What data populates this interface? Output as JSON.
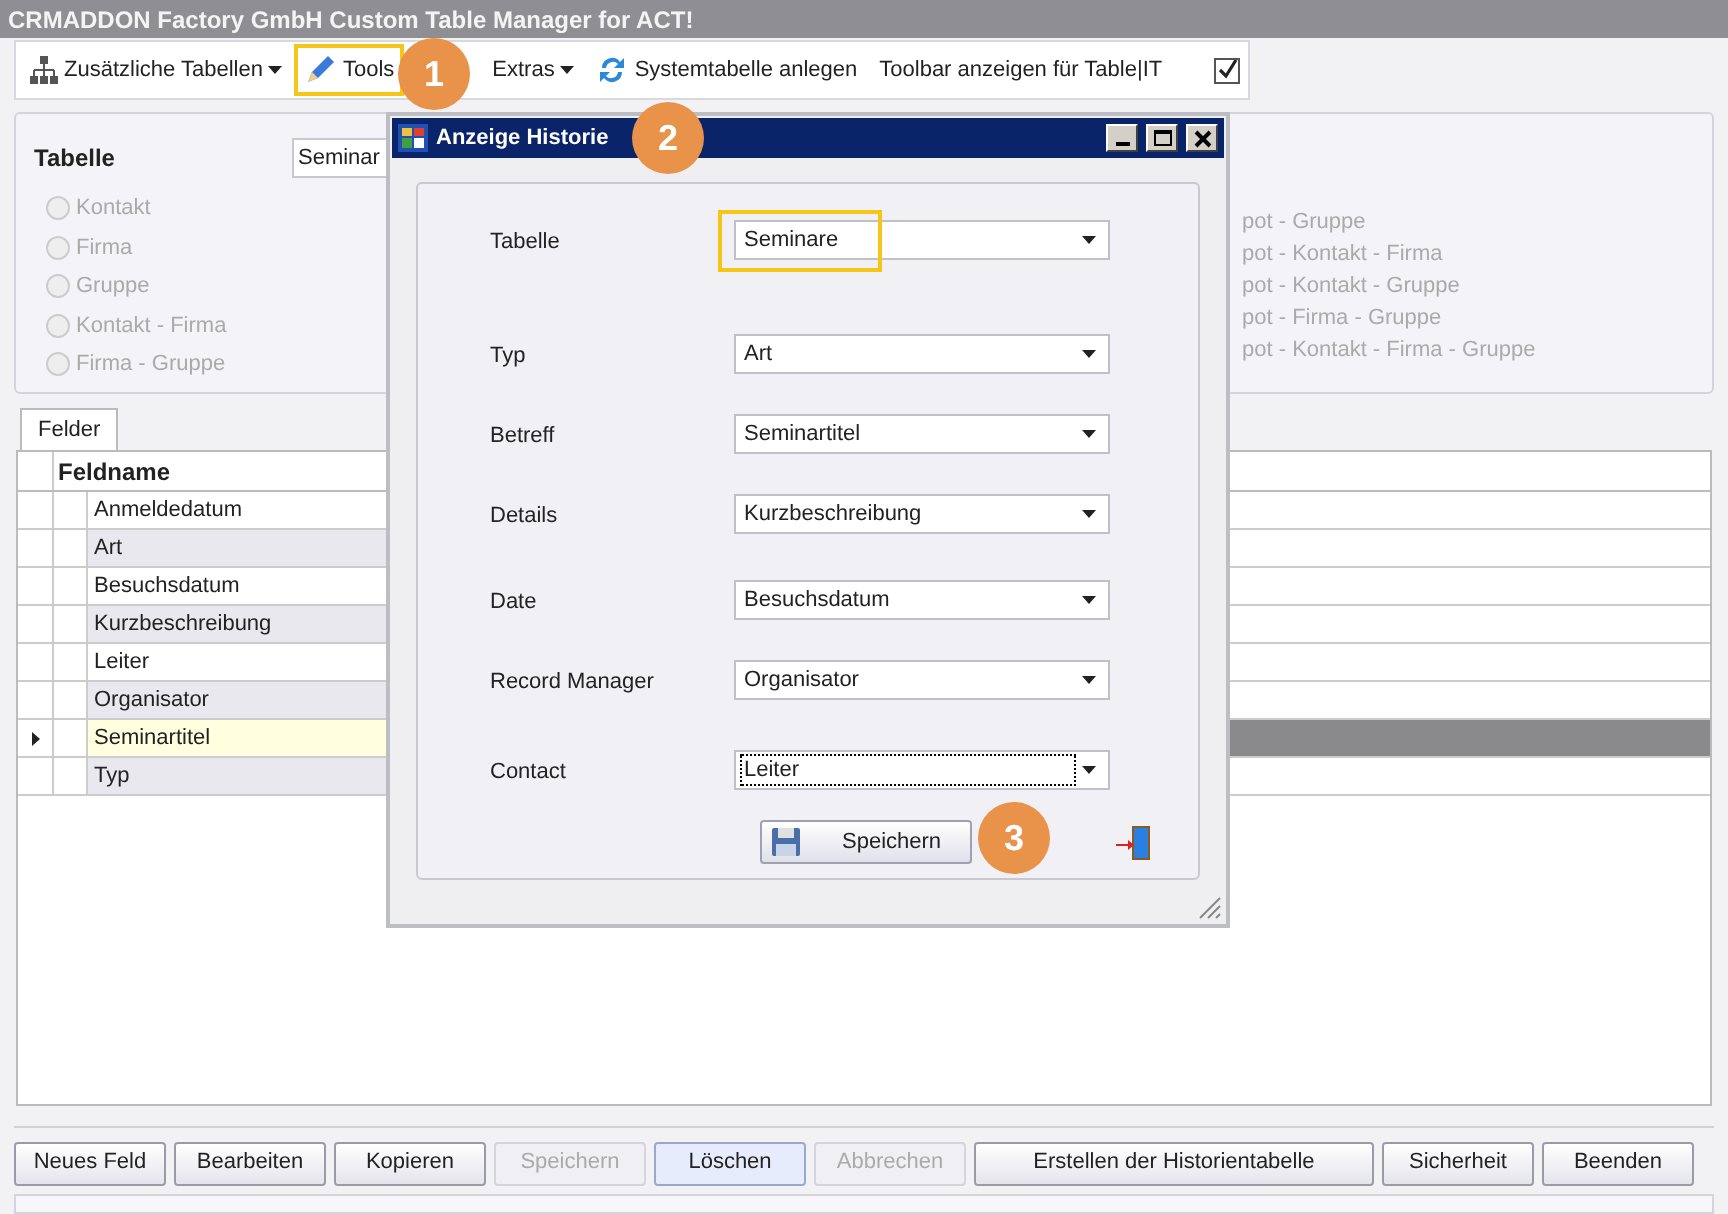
{
  "window": {
    "title": "CRMADDON Factory GmbH Custom Table Manager for ACT!"
  },
  "toolbar": [
    {
      "kind": "tables",
      "label": "Zusätzliche Tabellen",
      "dropdown": true,
      "highlighted": false
    },
    {
      "kind": "tools",
      "label": "Tools",
      "highlighted": true
    },
    {
      "kind": "plain",
      "label": "Extras",
      "dropdown": true,
      "highlighted": false
    },
    {
      "kind": "refresh",
      "label": "Systemtabelle anlegen",
      "dropdown": false,
      "highlighted": false
    },
    {
      "kind": "plain",
      "label": "Toolbar anzeigen für Table|IT",
      "dropdown": false,
      "highlighted": false
    },
    {
      "kind": "checkbox",
      "checked": true
    }
  ],
  "table_panel": {
    "label": "Tabelle",
    "value": "Seminar",
    "radios_left": [
      {
        "label": "Kontakt",
        "selected": false
      },
      {
        "label": "Firma",
        "selected": false
      },
      {
        "label": "Gruppe",
        "selected": false
      },
      {
        "label": "Kontakt - Firma",
        "selected": false
      },
      {
        "label": "Firma - Gruppe",
        "selected": false
      }
    ],
    "radios_right": [
      "pot - Gruppe",
      "pot - Kontakt - Firma",
      "pot - Kontakt - Gruppe",
      "pot - Firma - Gruppe",
      "pot - Kontakt - Firma - Gruppe"
    ]
  },
  "tabs": [
    {
      "label": "Felder",
      "selected": true
    }
  ],
  "grid": {
    "columns": [
      "Feldname"
    ],
    "rows": [
      {
        "name": "Anmeldedatum",
        "selected": false
      },
      {
        "name": "Art",
        "selected": false
      },
      {
        "name": "Besuchsdatum",
        "selected": false
      },
      {
        "name": "Kurzbeschreibung",
        "selected": false
      },
      {
        "name": "Leiter",
        "selected": false
      },
      {
        "name": "Organisator",
        "selected": false
      },
      {
        "name": "Seminartitel",
        "selected": true
      },
      {
        "name": "Typ",
        "selected": false
      }
    ]
  },
  "buttons": [
    {
      "label": "Neues Feld",
      "disabled": false,
      "focused": false
    },
    {
      "label": "Bearbeiten",
      "disabled": false,
      "focused": false
    },
    {
      "label": "Kopieren",
      "disabled": false,
      "focused": false
    },
    {
      "label": "Speichern",
      "disabled": true,
      "focused": false
    },
    {
      "label": "Löschen",
      "disabled": false,
      "focused": true
    },
    {
      "label": "Abbrechen",
      "disabled": true,
      "focused": false
    },
    {
      "label": "Erstellen der Historientabelle",
      "disabled": false,
      "focused": false
    },
    {
      "label": "Sicherheit",
      "disabled": false,
      "focused": false
    },
    {
      "label": "Beenden",
      "disabled": false,
      "focused": false
    }
  ],
  "dialog": {
    "title": "Anzeige Historie",
    "fields": [
      {
        "label": "Tabelle",
        "value": "Seminare",
        "highlighted": true,
        "focused": false
      },
      {
        "label": "Typ",
        "value": "Art",
        "highlighted": false,
        "focused": false
      },
      {
        "label": "Betreff",
        "value": "Seminartitel",
        "highlighted": false,
        "focused": false
      },
      {
        "label": "Details",
        "value": "Kurzbeschreibung",
        "highlighted": false,
        "focused": false
      },
      {
        "label": "Date",
        "value": "Besuchsdatum",
        "highlighted": false,
        "focused": false
      },
      {
        "label": "Record Manager",
        "value": "Organisator",
        "highlighted": false,
        "focused": false
      },
      {
        "label": "Contact",
        "value": "Leiter",
        "highlighted": false,
        "focused": true
      }
    ],
    "save_button": "Speichern"
  },
  "callouts": [
    "1",
    "2",
    "3"
  ]
}
